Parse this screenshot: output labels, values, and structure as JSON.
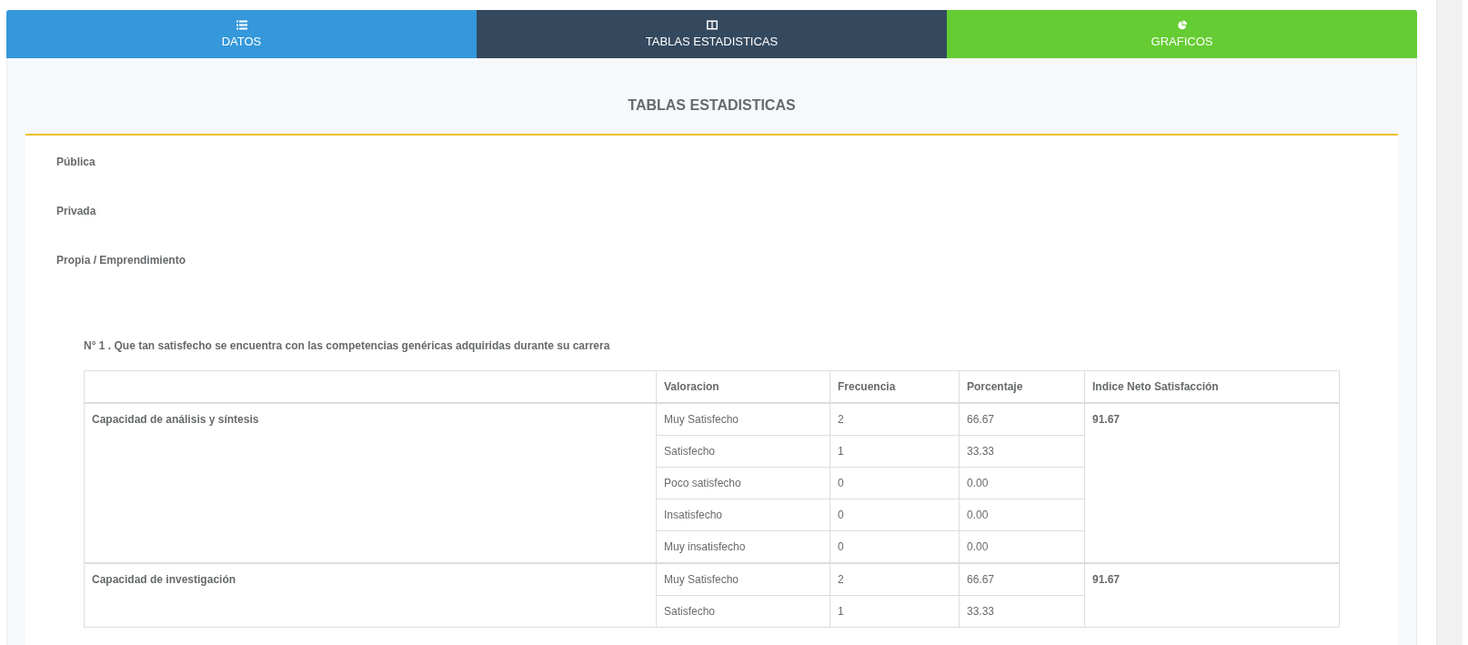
{
  "tabs": [
    {
      "label": "DATOS",
      "kind": "list",
      "color": "#3498db"
    },
    {
      "label": "TABLAS ESTADISTICAS",
      "kind": "columns",
      "color": "#34495e"
    },
    {
      "label": "GRAFICOS",
      "kind": "pie",
      "color": "#65cc33"
    }
  ],
  "panel": {
    "title": "TABLAS ESTADISTICAS"
  },
  "sectors": [
    "Pública",
    "Privada",
    "Propia / Emprendimiento"
  ],
  "question": "N° 1 . Que tan satisfecho se encuentra con las competencias genéricas adquiridas durante su carrera",
  "table": {
    "columns": [
      "Valoracion",
      "Frecuencia",
      "Porcentaje",
      "Indice Neto Satisfacción"
    ],
    "groups": [
      {
        "label": "Capacidad de análisis y síntesis",
        "index": "91.67",
        "rows": [
          {
            "valoracion": "Muy Satisfecho",
            "frecuencia": "2",
            "porcentaje": "66.67"
          },
          {
            "valoracion": "Satisfecho",
            "frecuencia": "1",
            "porcentaje": "33.33"
          },
          {
            "valoracion": "Poco satisfecho",
            "frecuencia": "0",
            "porcentaje": "0.00"
          },
          {
            "valoracion": "Insatisfecho",
            "frecuencia": "0",
            "porcentaje": "0.00"
          },
          {
            "valoracion": "Muy insatisfecho",
            "frecuencia": "0",
            "porcentaje": "0.00"
          }
        ]
      },
      {
        "label": "Capacidad de investigación",
        "index": "91.67",
        "rows": [
          {
            "valoracion": "Muy Satisfecho",
            "frecuencia": "2",
            "porcentaje": "66.67"
          },
          {
            "valoracion": "Satisfecho",
            "frecuencia": "1",
            "porcentaje": "33.33"
          }
        ]
      }
    ]
  }
}
